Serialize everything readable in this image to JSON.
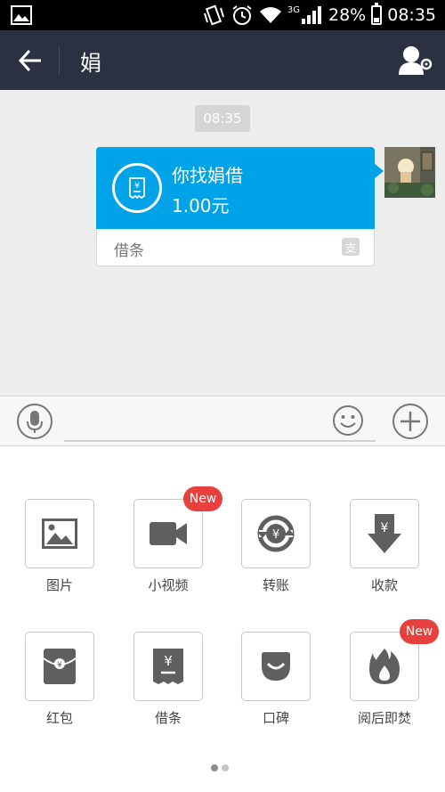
{
  "status_bar": {
    "network": "3G",
    "battery": "28%",
    "battery_level": 0.28,
    "time": "08:35",
    "icons": [
      "gallery-icon",
      "vibrate-icon",
      "alarm-icon",
      "wifi-icon",
      "signal-icon",
      "battery-icon"
    ]
  },
  "title_bar": {
    "title": "娟",
    "back_icon": "back-arrow-icon",
    "settings_icon": "user-settings-icon"
  },
  "chat": {
    "timestamp": "08:35",
    "message": {
      "title": "你找娟借",
      "amount": "1.00元",
      "type_label": "借条",
      "icon": "receipt-icon",
      "brand_icon": "alipay-icon"
    }
  },
  "input_bar": {
    "voice_icon": "microphone-icon",
    "emoji_icon": "smiley-icon",
    "more_icon": "plus-icon"
  },
  "panel": {
    "items": [
      {
        "label": "图片",
        "icon": "image-icon",
        "badge": ""
      },
      {
        "label": "小视频",
        "icon": "video-camera-icon",
        "badge": "New"
      },
      {
        "label": "转账",
        "icon": "transfer-icon",
        "badge": ""
      },
      {
        "label": "收款",
        "icon": "receive-money-icon",
        "badge": ""
      },
      {
        "label": "红包",
        "icon": "red-envelope-icon",
        "badge": ""
      },
      {
        "label": "借条",
        "icon": "receipt-icon",
        "badge": ""
      },
      {
        "label": "口碑",
        "icon": "koubei-icon",
        "badge": ""
      },
      {
        "label": "阅后即焚",
        "icon": "flame-icon",
        "badge": "New"
      }
    ],
    "page_count": 2,
    "current_page": 1
  },
  "colors": {
    "title_bar_bg": "#2b3141",
    "bubble_blue": "#00a3e8",
    "badge_red": "#e8403c",
    "chat_bg": "#ededed"
  }
}
